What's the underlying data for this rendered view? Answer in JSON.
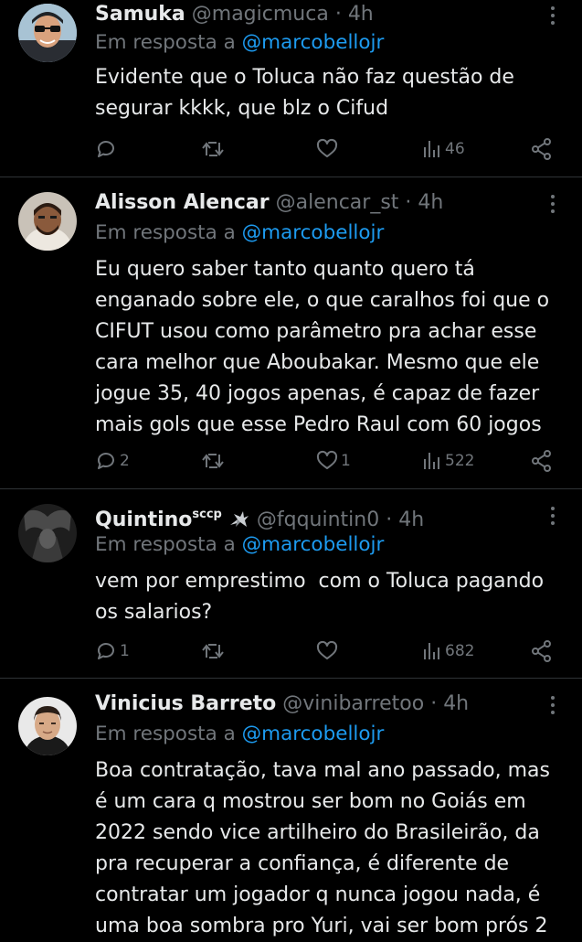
{
  "tweets": [
    {
      "name": "Samuka",
      "name_sup": "",
      "handle": "@magicmuca",
      "dot": "·",
      "time": "4h",
      "reply_prefix": "Em resposta a",
      "reply_mention": "@marcobellojr",
      "text": "Evidente que o Toluca não faz questão de segurar kkkk, que blz o Cifud",
      "replies": "",
      "retweets": "",
      "likes": "",
      "views": "46"
    },
    {
      "name": "Alisson Alencar",
      "name_sup": "",
      "handle": "@alencar_st",
      "dot": "·",
      "time": "4h",
      "reply_prefix": "Em resposta a",
      "reply_mention": "@marcobellojr",
      "text": "Eu quero saber tanto quanto quero tá enganado sobre ele, o que caralhos foi que o CIFUT usou como parâmetro pra achar esse cara melhor que Aboubakar. Mesmo que ele jogue 35, 40 jogos apenas, é capaz de fazer mais gols que esse Pedro Raul com 60 jogos",
      "replies": "2",
      "retweets": "",
      "likes": "1",
      "views": "522"
    },
    {
      "name": "Quintino",
      "name_sup": "sccp",
      "handle": "@fqquintin0",
      "dot": "·",
      "time": "4h",
      "reply_prefix": "Em resposta a",
      "reply_mention": "@marcobellojr",
      "text": "vem por emprestimo  com o Toluca pagando os salarios?",
      "replies": "1",
      "retweets": "",
      "likes": "",
      "views": "682"
    },
    {
      "name": "Vinicius Barreto",
      "name_sup": "",
      "handle": "@vinibarretoo",
      "dot": "·",
      "time": "4h",
      "reply_prefix": "Em resposta a",
      "reply_mention": "@marcobellojr",
      "text": "Boa contratação, tava mal ano passado, mas é um cara q mostrou ser bom no Goiás em 2022 sendo vice artilheiro do Brasileirão, da pra recuperar a confiança, é diferente de contratar um jogador q nunca jogou nada, é uma boa sombra pro Yuri, vai ser bom prós 2",
      "replies": "",
      "retweets": "",
      "likes": "",
      "views": ""
    }
  ],
  "colors": {
    "background": "#000000",
    "text": "#e7e9ea",
    "muted": "#71767b",
    "link": "#1d9bf0",
    "divider": "#2f3336"
  },
  "icons": [
    "reply-icon",
    "retweet-icon",
    "like-icon",
    "views-icon",
    "share-icon",
    "more-icon",
    "bird-emoji-icon"
  ]
}
